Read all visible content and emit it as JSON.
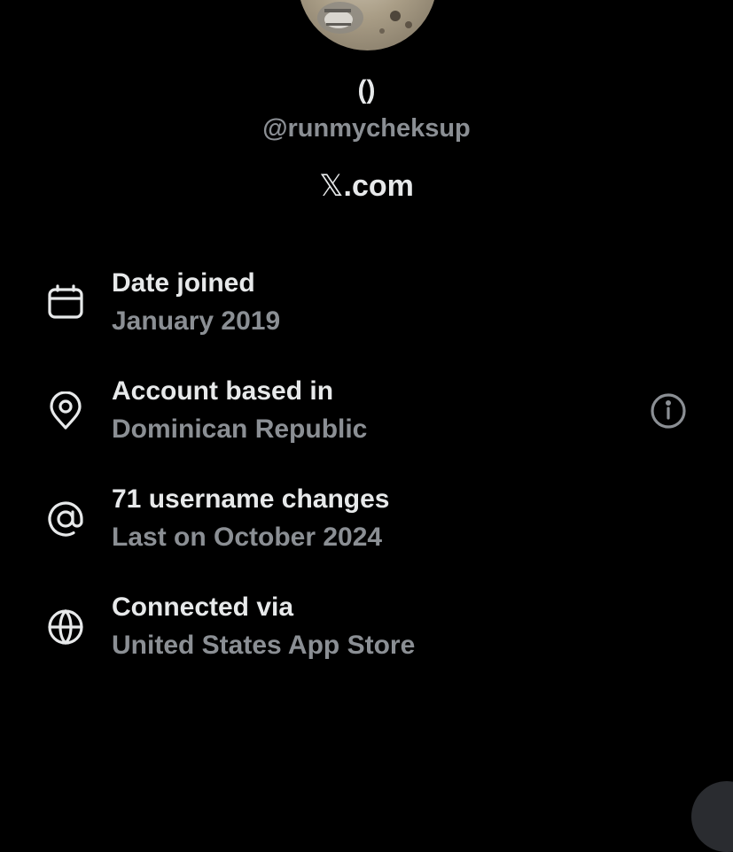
{
  "profile": {
    "display_name": "()",
    "handle": "@runmycheksup",
    "site_suffix": ".com",
    "site_logo_glyph": "𝕏"
  },
  "about": {
    "rows": [
      {
        "icon": "calendar-icon",
        "label": "Date joined",
        "value": "January 2019"
      },
      {
        "icon": "location-pin-icon",
        "label": "Account based in",
        "value": "Dominican Republic"
      },
      {
        "icon": "at-sign-icon",
        "label": "71 username changes",
        "value": "Last on October 2024"
      },
      {
        "icon": "globe-icon",
        "label": "Connected via",
        "value": "United States App Store"
      }
    ]
  },
  "colors": {
    "background": "#000000",
    "primary_text": "#e7e9ea",
    "secondary_text": "#8b8f94"
  }
}
